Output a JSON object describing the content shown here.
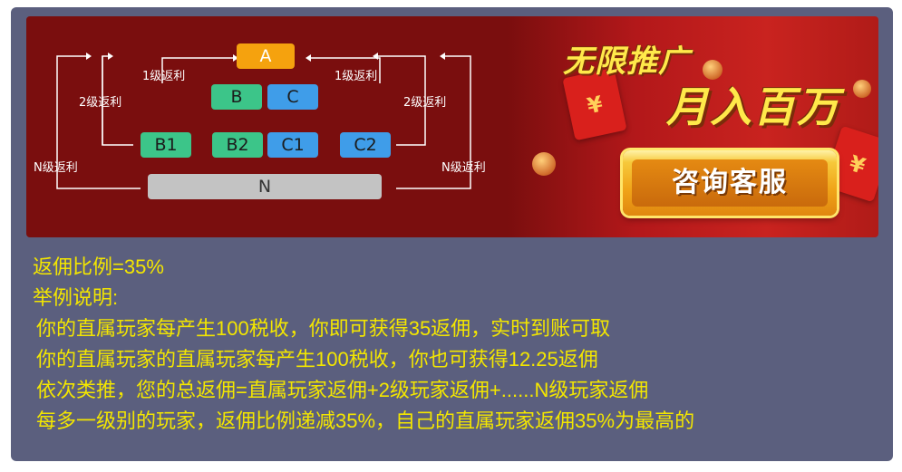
{
  "diagram": {
    "nodes": {
      "a": "A",
      "b": "B",
      "c": "C",
      "b1": "B1",
      "b2": "B2",
      "c1": "C1",
      "c2": "C2",
      "n": "N"
    },
    "labels": {
      "level1_left": "1级返利",
      "level1_right": "1级返利",
      "level2_left": "2级返利",
      "level2_right": "2级返利",
      "leveln_left": "N级返利",
      "leveln_right": "N级返利"
    },
    "colors": {
      "green": "#3cc589",
      "blue": "#3f9de9",
      "orange": "#f5a20e",
      "gray": "#c3c3c3"
    }
  },
  "promo": {
    "slogan_top": "无限推广",
    "slogan_main": "月入百万",
    "button_label": "咨询客服",
    "envelope_symbol": "¥"
  },
  "info": {
    "ratio": "返佣比例=35%",
    "example_title": "举例说明:",
    "lines": [
      "你的直属玩家每产生100税收，你即可获得35返佣，实时到账可取",
      "你的直属玩家的直属玩家每产生100税收，你也可获得12.25返佣",
      "依次类推，您的总返佣=直属玩家返佣+2级玩家返佣+......N级玩家返佣",
      "每多一级别的玩家，返佣比例递减35%，自己的直属玩家返佣35%为最高的"
    ]
  }
}
